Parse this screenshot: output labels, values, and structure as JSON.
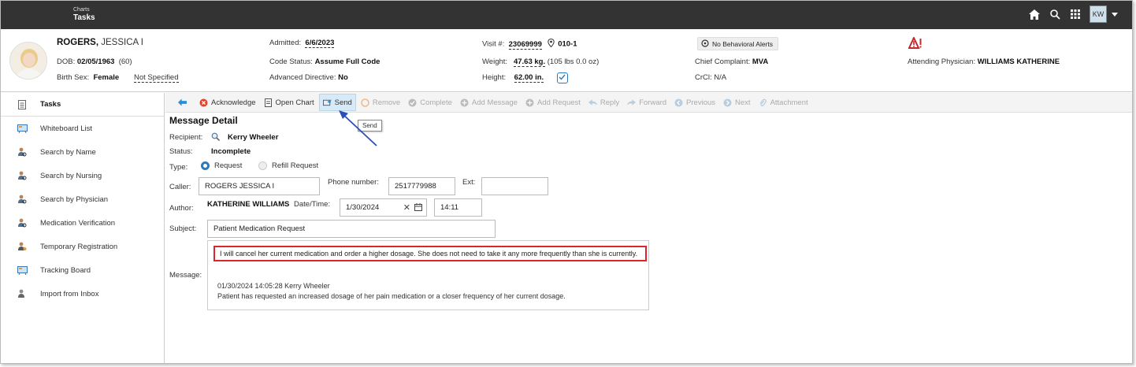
{
  "topbar": {
    "breadcrumb": "Charts",
    "title": "Tasks",
    "user_initials": "KW"
  },
  "patient": {
    "last_name": "ROGERS,",
    "first_name": "JESSICA I",
    "dob_label": "DOB:",
    "dob": "02/05/1963",
    "age": "(60)",
    "sex_label": "Birth Sex:",
    "sex": "Female",
    "sex_extra": "Not Specified",
    "admitted_label": "Admitted:",
    "admitted": "6/6/2023",
    "code_status_label": "Code Status:",
    "code_status": "Assume Full Code",
    "adv_dir_label": "Advanced Directive:",
    "adv_dir": "No",
    "visit_label": "Visit #:",
    "visit": "23069999",
    "room": "010-1",
    "weight_label": "Weight:",
    "weight": "47.63 kg.",
    "weight_alt": "(105 lbs 0.0 oz)",
    "height_label": "Height:",
    "height": "62.00 in.",
    "behavioral": "No Behavioral Alerts",
    "complaint_label": "Chief Complaint:",
    "complaint": "MVA",
    "crcl_label": "CrCl:",
    "crcl": "N/A",
    "attending_label": "Attending Physician:",
    "attending": "WILLIAMS KATHERINE",
    "alert_color": "#c0282d"
  },
  "sidebar": {
    "items": [
      {
        "label": "Tasks",
        "icon": "tasks-icon"
      },
      {
        "label": "Whiteboard List",
        "icon": "whiteboard-icon"
      },
      {
        "label": "Search by Name",
        "icon": "person-search-icon"
      },
      {
        "label": "Search by Nursing",
        "icon": "person-search-icon"
      },
      {
        "label": "Search by Physician",
        "icon": "person-search-icon"
      },
      {
        "label": "Medication Verification",
        "icon": "person-search-icon"
      },
      {
        "label": "Temporary Registration",
        "icon": "person-add-icon"
      },
      {
        "label": "Tracking Board",
        "icon": "board-icon"
      },
      {
        "label": "Import from Inbox",
        "icon": "import-icon"
      }
    ]
  },
  "toolbar": {
    "acknowledge": "Acknowledge",
    "open_chart": "Open Chart",
    "send": "Send",
    "remove": "Remove",
    "complete": "Complete",
    "add_message": "Add Message",
    "add_request": "Add Request",
    "reply": "Reply",
    "forward": "Forward",
    "previous": "Previous",
    "next": "Next",
    "attachment": "Attachment",
    "tooltip": "Send"
  },
  "detail": {
    "title": "Message Detail",
    "recipient_label": "Recipient:",
    "recipient": "Kerry Wheeler",
    "status_label": "Status:",
    "status": "Incomplete",
    "type_label": "Type:",
    "type_request": "Request",
    "type_refill": "Refill Request",
    "caller_label": "Caller:",
    "caller": "ROGERS JESSICA I",
    "phone_label": "Phone number:",
    "phone": "2517779988",
    "ext_label": "Ext:",
    "ext": "",
    "author_label": "Author:",
    "author": "KATHERINE WILLIAMS",
    "datetime_label": "Date/Time:",
    "date": "1/30/2024",
    "time": "14:11",
    "subject_label": "Subject:",
    "subject": "Patient Medication Request",
    "message_label": "Message:",
    "new_message": "I will cancel her current medication and order a higher dosage. She does not need to take it any more frequently than she is currently.",
    "history_header": "01/30/2024 14:05:28 Kerry Wheeler",
    "history_body": "Patient has requested an increased dosage of her pain medication or a closer frequency of her current dosage."
  }
}
